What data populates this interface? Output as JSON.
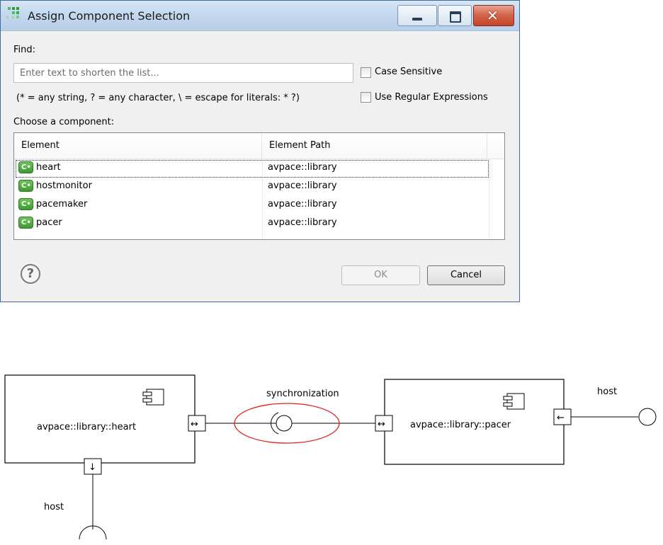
{
  "dialog": {
    "title": "Assign Component Selection",
    "find_label": "Find:",
    "find_placeholder": "Enter text to shorten the list...",
    "find_value": "",
    "case_sensitive_label": "Case Sensitive",
    "case_sensitive_checked": false,
    "regex_label": "Use Regular Expressions",
    "regex_checked": false,
    "hint": "(* = any string, ? = any character, \\ = escape for literals: * ?)",
    "choose_label": "Choose a component:",
    "table": {
      "columns": [
        "Element",
        "Element Path"
      ],
      "rows": [
        {
          "element": "heart",
          "path": "avpace::library"
        },
        {
          "element": "hostmonitor",
          "path": "avpace::library"
        },
        {
          "element": "pacemaker",
          "path": "avpace::library"
        },
        {
          "element": "pacer",
          "path": "avpace::library"
        }
      ],
      "selected_index": 0,
      "row_icon": "component-icon",
      "row_icon_text": "C•"
    },
    "ok_label": "OK",
    "cancel_label": "Cancel",
    "ok_enabled": false,
    "help_icon": "question-mark-icon"
  },
  "diagram": {
    "left_component": "avpace::library::heart",
    "right_component": "avpace::library::pacer",
    "interface_label": "synchronization",
    "host_right_label": "host",
    "host_bottom_label": "host",
    "highlight_color": "#e02020"
  }
}
